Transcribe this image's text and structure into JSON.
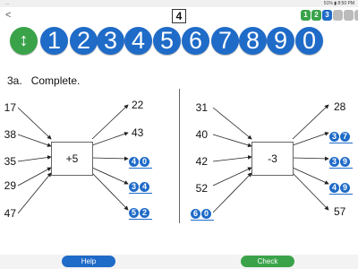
{
  "status": {
    "left": "...",
    "right": "51% ▮ 8:50 PM"
  },
  "topbar": {
    "back": "<",
    "page": "4",
    "levels": [
      "1",
      "2",
      "3",
      "",
      "",
      ""
    ]
  },
  "number_buttons": [
    "↕",
    "1",
    "2",
    "3",
    "4",
    "5",
    "6",
    "7",
    "8",
    "9",
    "0"
  ],
  "question": {
    "label": "3a.",
    "text": "Complete."
  },
  "left": {
    "inputs": [
      "17",
      "38",
      "35",
      "29",
      "47"
    ],
    "operation": "+5",
    "outputs": [
      {
        "text": "22",
        "answered": false
      },
      {
        "text": "43",
        "answered": false
      },
      {
        "digits": [
          "4",
          "0"
        ],
        "answered": true
      },
      {
        "digits": [
          "3",
          "4"
        ],
        "answered": true
      },
      {
        "digits": [
          "5",
          "2"
        ],
        "answered": true
      }
    ]
  },
  "right": {
    "inputs": [
      {
        "text": "31"
      },
      {
        "text": "40"
      },
      {
        "text": "42"
      },
      {
        "text": "52"
      },
      {
        "digits": [
          "6",
          "0"
        ]
      }
    ],
    "operation": "-3",
    "outputs": [
      {
        "text": "28"
      },
      {
        "digits": [
          "3",
          "7"
        ]
      },
      {
        "digits": [
          "3",
          "9"
        ]
      },
      {
        "digits": [
          "4",
          "9"
        ]
      },
      {
        "text": "57"
      }
    ]
  },
  "buttons": {
    "help": "Help",
    "check": "Check"
  },
  "colors": {
    "blue": "#1f6bc8",
    "green": "#3aa34a"
  }
}
